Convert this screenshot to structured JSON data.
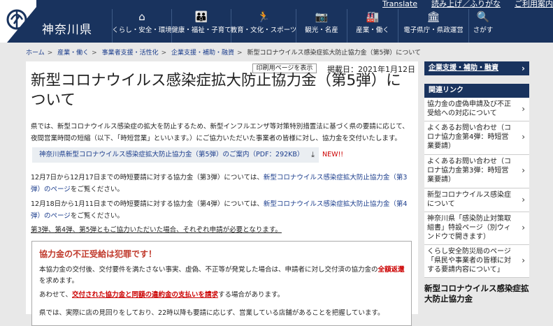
{
  "header": {
    "top_links": [
      "Translate",
      "読み上げ／ふりがな",
      "ご利用案内"
    ],
    "site_title": "神奈川県",
    "nav": [
      {
        "icon": "home-icon",
        "label": "くらし・安全・環境"
      },
      {
        "icon": "family-icon",
        "label": "健康・福祉・子育て"
      },
      {
        "icon": "runner-icon",
        "label": "教育・文化・スポーツ"
      },
      {
        "icon": "camera-icon",
        "label": "観光・名産"
      },
      {
        "icon": "factory-icon",
        "label": "産業・働く"
      },
      {
        "icon": "government-icon",
        "label": "電子県庁・県政運営"
      },
      {
        "icon": "search-icon",
        "label": "さがす"
      }
    ]
  },
  "breadcrumb": [
    "ホーム",
    "産業・働く",
    "事業者支援・活性化",
    "企業支援・補助・融資",
    "新型コロナウイルス感染症拡大防止協力金（第5弾）について"
  ],
  "main": {
    "print_label": "印刷用ページを表示",
    "published": "掲載日：2021年1月12日",
    "title": "新型コロナウイルス感染症拡大防止協力金（第5弾）について",
    "intro": "県では、新型コロナウイルス感染症の拡大を防止するため、新型インフルエンザ等対策特別措置法に基づく県の要請に応じて、夜間営業時間の短縮（以下、「時短営業」といいます。）にご協力いただいた事業者の皆様に対し、協力金を交付いたします。",
    "download_label": "神奈川県新型コロナウイルス感染症拡大防止協力金（第5弾）のご案内（PDF：292KB）",
    "new_tag": "NEW!!",
    "p3_a": "12月7日から12月17日までの時短要請に対する協力金（第3弾）については、",
    "p3_link": "新型コロナウイルス感染症拡大防止協力金（第3弾）のページ",
    "p3_b": "をご覧ください。",
    "p4_a": "12月18日から1月11日までの時短要請に対する協力金（第4弾）については、",
    "p4_link": "新型コロナウイルス感染症拡大防止協力金（第4弾）のページ",
    "p4_b": "をご覧ください。",
    "note": "第3弾、第4弾、第5弾ともご協力いただいた場合、それぞれ申請が必要となります。",
    "warning": {
      "title": "協力金の不正受給は犯罪です！",
      "p1_a": "本協力金の交付後、交付要件を満たさない事実、虚偽、不正等が発覚した場合は、申請者に対し交付済の協力金の",
      "p1_red": "全額返還",
      "p1_b": "を求めます。",
      "p2_a": "あわせて、",
      "p2_red": "交付された協力金と同額の違約金の支払いを請求",
      "p2_b": "する場合があります。",
      "p3": "県では、実際に店の見回りをしており、22時以降も要請に応じず、営業している店舗があることを把握しています。"
    }
  },
  "sidebar": {
    "top_link": "企業支援・補助・融資",
    "related_head": "関連リンク",
    "items": [
      "協力金の虚偽申請及び不正受給への対応について",
      "よくあるお問い合わせ（コロナ協力金第4弾：時短営業要請）",
      "よくあるお問い合わせ（コロナ協力金第3弾：時短営業要請）",
      "新型コロナウイルス感染症について",
      "神奈川県「感染防止対策取組書」特設ページ（別ウィンドウで開きます）",
      "くらし安全防災局のページ「県民や事業者の皆様に対する要請内容について」"
    ],
    "bottom_title": "新型コロナウイルス感染症拡大防止協力金"
  }
}
